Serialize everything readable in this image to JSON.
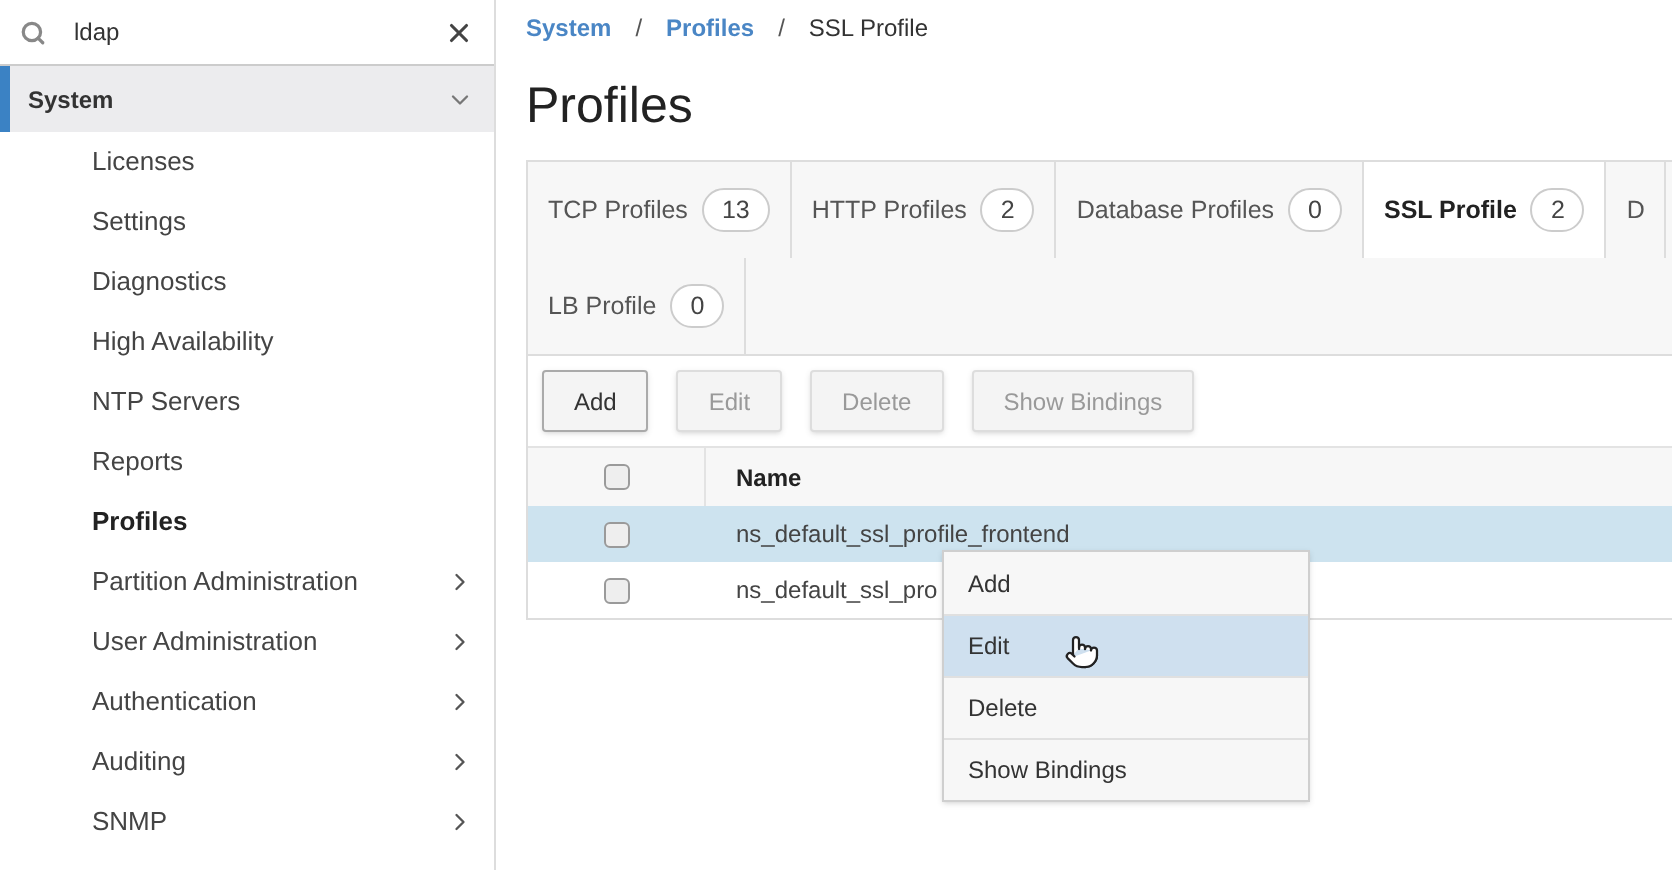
{
  "search": {
    "value": "ldap"
  },
  "sidebar": {
    "section": {
      "label": "System",
      "expanded": true
    },
    "items": [
      {
        "label": "Licenses",
        "selected": false,
        "has_children": false
      },
      {
        "label": "Settings",
        "selected": false,
        "has_children": false
      },
      {
        "label": "Diagnostics",
        "selected": false,
        "has_children": false
      },
      {
        "label": "High Availability",
        "selected": false,
        "has_children": false
      },
      {
        "label": "NTP Servers",
        "selected": false,
        "has_children": false
      },
      {
        "label": "Reports",
        "selected": false,
        "has_children": false
      },
      {
        "label": "Profiles",
        "selected": true,
        "has_children": false
      },
      {
        "label": "Partition Administration",
        "selected": false,
        "has_children": true
      },
      {
        "label": "User Administration",
        "selected": false,
        "has_children": true
      },
      {
        "label": "Authentication",
        "selected": false,
        "has_children": true
      },
      {
        "label": "Auditing",
        "selected": false,
        "has_children": true
      },
      {
        "label": "SNMP",
        "selected": false,
        "has_children": true
      }
    ]
  },
  "breadcrumb": [
    {
      "label": "System",
      "kind": "link"
    },
    {
      "label": "Profiles",
      "kind": "link"
    },
    {
      "label": "SSL Profile",
      "kind": "current"
    }
  ],
  "breadcrumb_separator": "/",
  "title": "Profiles",
  "tab_rows": [
    [
      {
        "label": "TCP Profiles",
        "count": "13",
        "selected": false
      },
      {
        "label": "HTTP Profiles",
        "count": "2",
        "selected": false
      },
      {
        "label": "Database Profiles",
        "count": "0",
        "selected": false
      },
      {
        "label": "SSL Profile",
        "count": "2",
        "selected": true
      },
      {
        "label": "D",
        "selected": false
      }
    ],
    [
      {
        "label": "LB Profile",
        "count": "0",
        "selected": false
      }
    ]
  ],
  "toolbar": [
    {
      "label": "Add",
      "disabled": false
    },
    {
      "label": "Edit",
      "disabled": true
    },
    {
      "label": "Delete",
      "disabled": true
    },
    {
      "label": "Show Bindings",
      "disabled": true
    }
  ],
  "table": {
    "header_checked": false,
    "columns": [
      "Name"
    ],
    "rows": [
      {
        "name": "ns_default_ssl_profile_frontend",
        "selected": true,
        "checked": false
      },
      {
        "name": "ns_default_ssl_pro",
        "selected": false,
        "checked": false
      }
    ]
  },
  "context_menu": [
    {
      "label": "Add",
      "highlighted": false
    },
    {
      "label": "Edit",
      "highlighted": true
    },
    {
      "label": "Delete",
      "highlighted": false
    },
    {
      "label": "Show Bindings",
      "highlighted": false
    }
  ]
}
